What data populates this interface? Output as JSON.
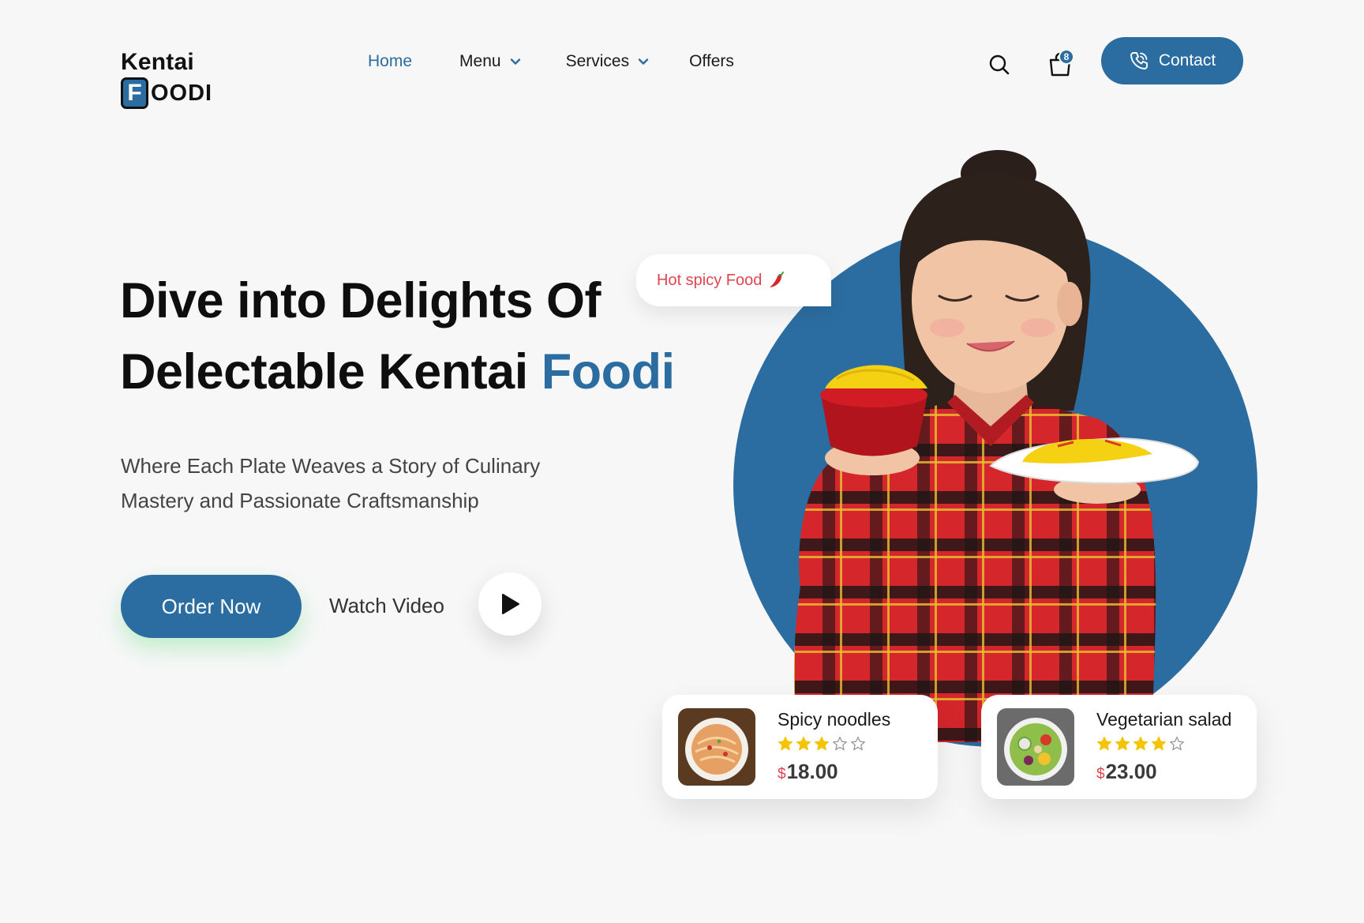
{
  "brand": {
    "line1": "Kentai",
    "initial": "F",
    "line2_rest": "OODI",
    "accent_color": "#2c6da1"
  },
  "nav": {
    "items": [
      {
        "label": "Home",
        "active": true,
        "dropdown": false
      },
      {
        "label": "Menu",
        "active": false,
        "dropdown": true
      },
      {
        "label": "Services",
        "active": false,
        "dropdown": true
      },
      {
        "label": "Offers",
        "active": false,
        "dropdown": false
      }
    ]
  },
  "header": {
    "search_icon": "search-icon",
    "cart_icon": "shopping-bag-icon",
    "cart_count": "8",
    "contact_label": "Contact",
    "contact_icon": "phone-icon"
  },
  "hero": {
    "title_line1": "Dive into Delights Of",
    "title_line2_plain": "Delectable Kentai ",
    "title_line2_accent": "Foodi",
    "subtitle_line1": "Where Each Plate Weaves a Story of Culinary",
    "subtitle_line2": "Mastery and Passionate Craftsmanship",
    "order_label": "Order Now",
    "watch_label": "Watch Video",
    "play_icon": "play-icon",
    "tag_label": "Hot spicy Food",
    "tag_icon": "chili-icon"
  },
  "products": [
    {
      "name": "Spicy noodles",
      "rating": 3,
      "max_rating": 5,
      "currency": "$",
      "price": "18.00"
    },
    {
      "name": "Vegetarian salad",
      "rating": 4,
      "max_rating": 5,
      "currency": "$",
      "price": "23.00"
    }
  ],
  "colors": {
    "primary": "#2c6da1",
    "highlight_red": "#e0464f",
    "star": "#f5c400"
  }
}
